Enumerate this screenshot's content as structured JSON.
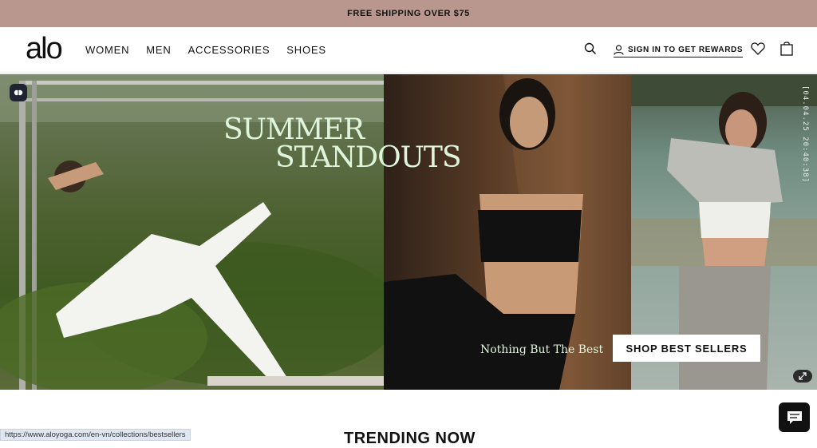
{
  "promo": {
    "text": "FREE SHIPPING OVER $75"
  },
  "header": {
    "logo": "alo",
    "nav": [
      "WOMEN",
      "MEN",
      "ACCESSORIES",
      "SHOES"
    ],
    "signin": "SIGN IN TO GET REWARDS",
    "icons": {
      "search": "search-icon",
      "user": "user-icon",
      "wishlist": "heart-icon",
      "cart": "bag-icon"
    }
  },
  "hero": {
    "headline_line1": "SUMMER",
    "headline_line2": "STANDOUTS",
    "tagline": "Nothing But The Best",
    "cta": "SHOP BEST SELLERS",
    "vertical_text": "[04.04.25 20:40:38]",
    "accent_color": "#dff5dc"
  },
  "section": {
    "title": "TRENDING NOW"
  },
  "status_url": "https://www.aloyoga.com/en-vn/collections/bestsellers",
  "colors": {
    "promo_bg": "#b9978f",
    "text": "#111111"
  }
}
